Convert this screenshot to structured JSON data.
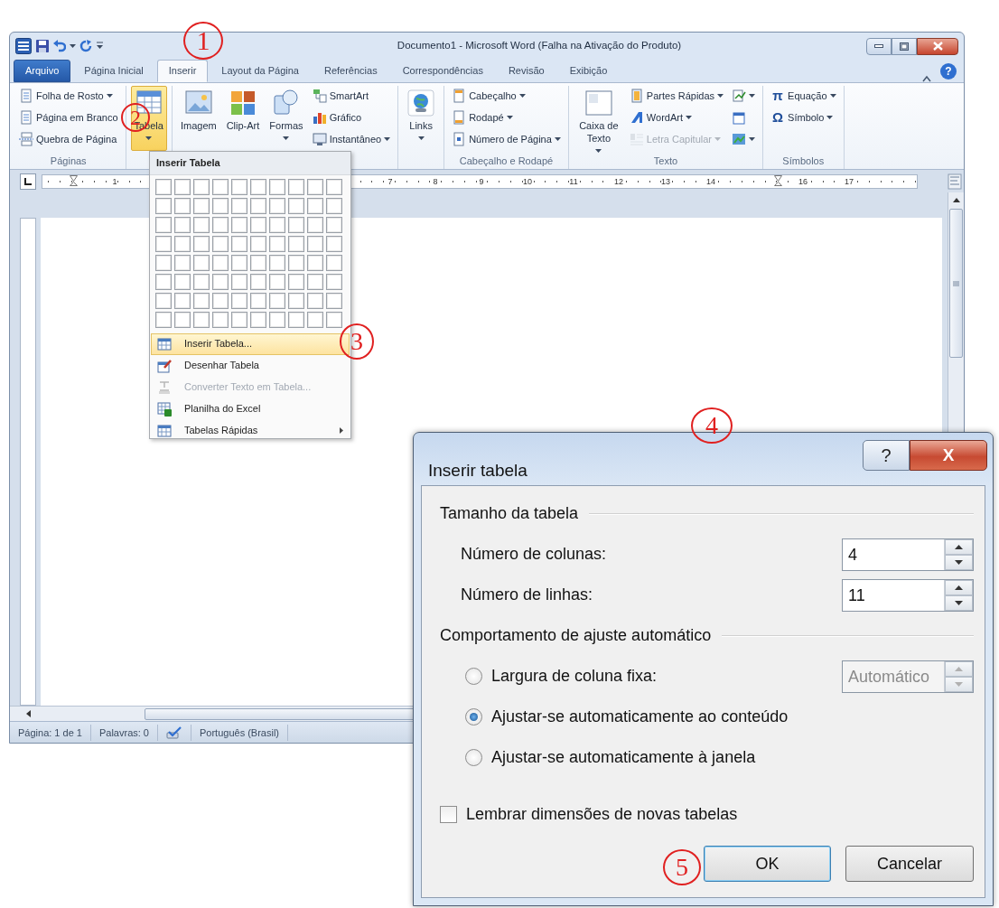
{
  "word_window": {
    "title": "Documento1 - Microsoft Word (Falha na Ativação do Produto)",
    "tabs": [
      {
        "label": "Arquivo",
        "kind": "file",
        "selected": false
      },
      {
        "label": "Página Inicial",
        "kind": "tab",
        "selected": false
      },
      {
        "label": "Inserir",
        "kind": "tab",
        "selected": true
      },
      {
        "label": "Layout da Página",
        "kind": "tab",
        "selected": false
      },
      {
        "label": "Referências",
        "kind": "tab",
        "selected": false
      },
      {
        "label": "Correspondências",
        "kind": "tab",
        "selected": false
      },
      {
        "label": "Revisão",
        "kind": "tab",
        "selected": false
      },
      {
        "label": "Exibição",
        "kind": "tab",
        "selected": false
      }
    ],
    "help": "?",
    "ribbon_groups": [
      {
        "label": "Páginas",
        "items": [
          {
            "label": "Folha de Rosto",
            "kind": "small",
            "dropdown": true,
            "disabled": false,
            "pressed": false
          },
          {
            "label": "Página em Branco",
            "kind": "small",
            "dropdown": false,
            "disabled": false,
            "pressed": false
          },
          {
            "label": "Quebra de Página",
            "kind": "small",
            "dropdown": false,
            "disabled": false,
            "pressed": false
          }
        ]
      },
      {
        "items": [
          {
            "label": "Tabela",
            "kind": "large",
            "dropdown": true,
            "disabled": false,
            "pressed": true
          }
        ]
      },
      {
        "items": [
          {
            "label": "Imagem",
            "kind": "large",
            "dropdown": false,
            "disabled": false,
            "pressed": false
          },
          {
            "label": "Clip-Art",
            "kind": "large",
            "dropdown": false,
            "disabled": false,
            "pressed": false
          },
          {
            "label": "Formas",
            "kind": "large",
            "dropdown": true,
            "disabled": false,
            "pressed": false
          },
          {
            "label": "SmartArt",
            "kind": "small",
            "dropdown": false,
            "disabled": false,
            "pressed": false
          },
          {
            "label": "Gráfico",
            "kind": "small",
            "dropdown": false,
            "disabled": false,
            "pressed": false
          },
          {
            "label": "Instantâneo",
            "kind": "small",
            "dropdown": true,
            "disabled": false,
            "pressed": false
          }
        ]
      },
      {
        "items": [
          {
            "label": "Links",
            "kind": "large",
            "dropdown": true,
            "disabled": false,
            "pressed": false
          }
        ]
      },
      {
        "label": "Cabeçalho e Rodapé",
        "items": [
          {
            "label": "Cabeçalho",
            "kind": "small",
            "dropdown": true,
            "disabled": false,
            "pressed": false
          },
          {
            "label": "Rodapé",
            "kind": "small",
            "dropdown": true,
            "disabled": false,
            "pressed": false
          },
          {
            "label": "Número de Página",
            "kind": "small",
            "dropdown": true,
            "disabled": false,
            "pressed": false
          }
        ]
      },
      {
        "label": "Texto",
        "items": [
          {
            "label": "Caixa de Texto",
            "kind": "large",
            "dropdown": true,
            "disabled": false,
            "pressed": false
          },
          {
            "label": "Partes Rápidas",
            "kind": "small",
            "dropdown": true,
            "disabled": false,
            "pressed": false
          },
          {
            "label": "WordArt",
            "kind": "small",
            "dropdown": true,
            "disabled": false,
            "pressed": false
          },
          {
            "label": "Letra Capitular",
            "kind": "small",
            "dropdown": true,
            "disabled": true,
            "pressed": false
          },
          {
            "kind": "icon",
            "dropdown": true,
            "disabled": false,
            "pressed": false
          },
          {
            "kind": "icon",
            "dropdown": false,
            "disabled": false,
            "pressed": false
          },
          {
            "kind": "icon",
            "dropdown": true,
            "disabled": false,
            "pressed": false
          }
        ]
      },
      {
        "label": "Símbolos",
        "items": [
          {
            "label": "Equação",
            "glyph": "π",
            "kind": "small",
            "dropdown": true,
            "disabled": false,
            "pressed": false
          },
          {
            "label": "Símbolo",
            "glyph": "Ω",
            "kind": "small",
            "dropdown": true,
            "disabled": false,
            "pressed": false
          }
        ]
      }
    ],
    "ruler_numbers": [
      "1",
      "7",
      "8",
      "9",
      "10",
      "11",
      "12",
      "13",
      "14",
      "16",
      "17"
    ],
    "status_bar": [
      "Página: 1 de 1",
      "Palavras: 0",
      "Português (Brasil)"
    ]
  },
  "table_menu": {
    "header": "Inserir Tabela",
    "items": [
      {
        "label": "Inserir Tabela...",
        "selected": true,
        "disabled": false,
        "submenu": false
      },
      {
        "label": "Desenhar Tabela",
        "selected": false,
        "disabled": false,
        "submenu": false
      },
      {
        "label": "Converter Texto em Tabela...",
        "selected": false,
        "disabled": true,
        "submenu": false
      },
      {
        "label": "Planilha do Excel",
        "selected": false,
        "disabled": false,
        "submenu": false
      },
      {
        "label": "Tabelas Rápidas",
        "selected": false,
        "disabled": false,
        "submenu": true
      }
    ]
  },
  "dialog": {
    "title": "Inserir tabela",
    "help": "?",
    "close": "X",
    "sections": [
      {
        "title": "Tamanho da tabela",
        "rows": [
          {
            "kind": "spinner",
            "label": "Número de colunas:",
            "value": "4",
            "disabled": false
          },
          {
            "kind": "spinner",
            "label": "Número de linhas:",
            "value": "11",
            "disabled": false
          }
        ]
      },
      {
        "title": "Comportamento de ajuste automático",
        "rows": [
          {
            "kind": "radio",
            "label": "Largura de coluna fixa:",
            "selected": false,
            "field": {
              "value": "Automático",
              "disabled": true
            }
          },
          {
            "kind": "radio",
            "label": "Ajustar-se automaticamente ao conteúdo",
            "selected": true
          },
          {
            "kind": "radio",
            "label": "Ajustar-se automaticamente à janela",
            "selected": false
          }
        ]
      }
    ],
    "remember": {
      "label": "Lembrar dimensões de novas tabelas",
      "checked": false
    },
    "buttons": [
      {
        "label": "OK",
        "default": true
      },
      {
        "label": "Cancelar",
        "default": false
      }
    ]
  },
  "callouts": [
    {
      "label": "1"
    },
    {
      "label": "2"
    },
    {
      "label": "3"
    },
    {
      "label": "4"
    },
    {
      "label": "5"
    }
  ]
}
